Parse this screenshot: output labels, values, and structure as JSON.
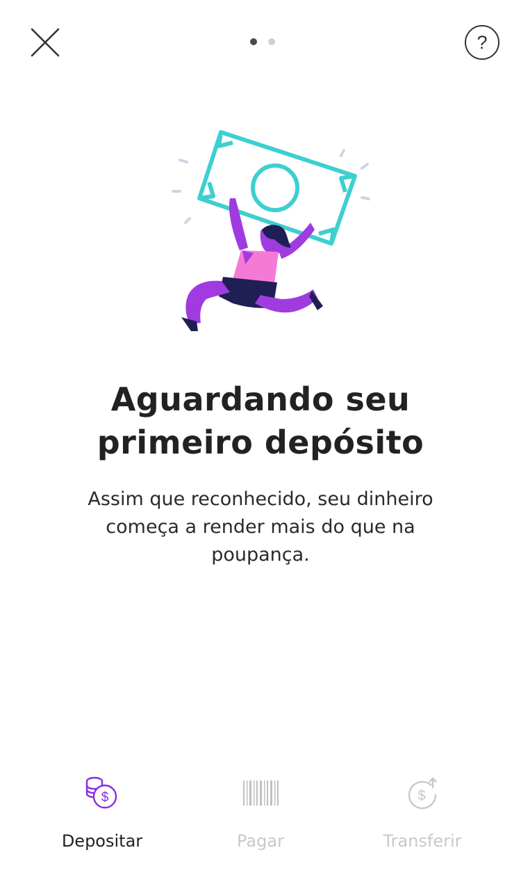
{
  "header": {
    "close_icon": "close-icon",
    "help_label": "?",
    "pager": {
      "count": 2,
      "active_index": 0
    }
  },
  "illustration": {
    "name": "person-carrying-money-illustration",
    "colors": {
      "banknote": "#3ecfcf",
      "body": "#a03be0",
      "top": "#f57ad6",
      "shorts": "#1f1f55",
      "sparkles": "#cfd4e2"
    }
  },
  "main": {
    "title_line1": "Aguardando seu",
    "title_line2": "primeiro depósito",
    "subtitle": "Assim que reconhecido, seu dinheiro começa a render mais do que na poupança."
  },
  "bottom_nav": {
    "items": [
      {
        "label": "Depositar",
        "icon": "coins-dollar-icon",
        "active": true
      },
      {
        "label": "Pagar",
        "icon": "barcode-icon",
        "active": false
      },
      {
        "label": "Transferir",
        "icon": "dollar-arrow-icon",
        "active": false
      }
    ],
    "active_color": "#8a2be2",
    "inactive_color": "#c8c8c8"
  }
}
